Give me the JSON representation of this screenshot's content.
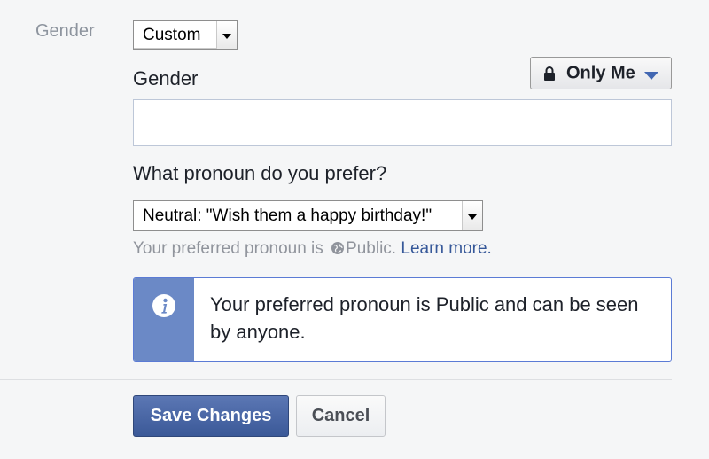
{
  "gender_row": {
    "label": "Gender",
    "select_value": "Custom"
  },
  "custom_gender": {
    "label": "Gender",
    "input_value": "",
    "audience": {
      "label": "Only Me",
      "icon": "lock-icon"
    }
  },
  "pronoun": {
    "question": "What pronoun do you prefer?",
    "select_value": "Neutral: \"Wish them a happy birthday!\"",
    "hint_prefix": "Your preferred pronoun is",
    "hint_audience": "Public.",
    "hint_link": "Learn more."
  },
  "info_box": {
    "icon": "info-icon",
    "text": "Your preferred pronoun is Public and can be seen by anyone."
  },
  "buttons": {
    "save": "Save Changes",
    "cancel": "Cancel"
  },
  "colors": {
    "primary_blue": "#4267b2",
    "info_side": "#6b89c6",
    "link": "#365899",
    "muted_text": "#90949c"
  }
}
